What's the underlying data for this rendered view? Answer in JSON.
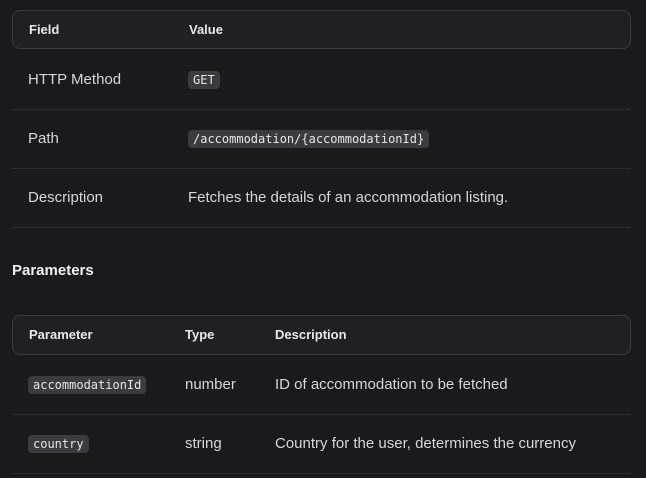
{
  "endpoint_table": {
    "headers": {
      "field": "Field",
      "value": "Value"
    },
    "rows": [
      {
        "field": "HTTP Method",
        "value": "GET",
        "is_code": true
      },
      {
        "field": "Path",
        "value": "/accommodation/{accommodationId}",
        "is_code": true
      },
      {
        "field": "Description",
        "value": "Fetches the details of an accommodation listing.",
        "is_code": false
      }
    ]
  },
  "parameters_section": {
    "title": "Parameters"
  },
  "parameters_table": {
    "headers": {
      "parameter": "Parameter",
      "type": "Type",
      "description": "Description"
    },
    "rows": [
      {
        "parameter": "accommodationId",
        "type": "number",
        "description": "ID of accommodation to be fetched"
      },
      {
        "parameter": "country",
        "type": "string",
        "description": "Country for the user, determines the currency"
      }
    ]
  },
  "colors": {
    "background": "#1a1a1c",
    "header_background": "#202023",
    "border": "#3a3a3f",
    "code_background": "#3a3a40",
    "text": "#d6d6da"
  }
}
